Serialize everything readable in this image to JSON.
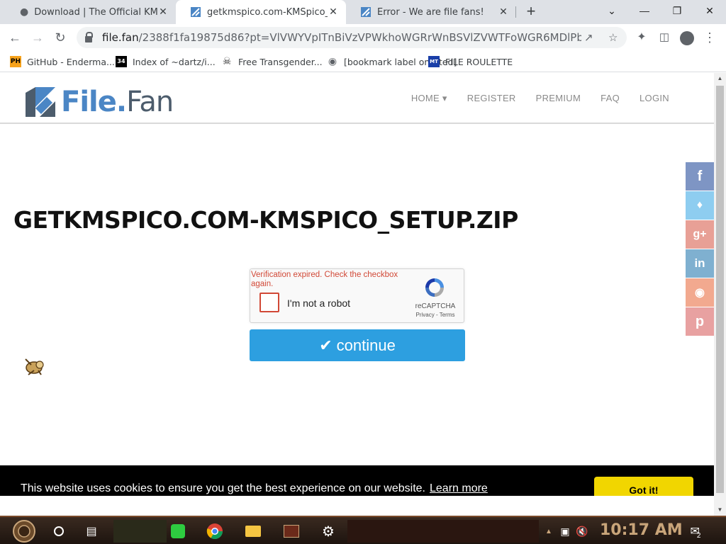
{
  "browser": {
    "tabs": [
      {
        "title": "Download | The Official KMSpico",
        "active": false
      },
      {
        "title": "getkmspico.com-KMSpico_setup.zip",
        "active": true
      },
      {
        "title": "Error - We are file fans!",
        "active": false
      }
    ],
    "url_host": "file.fan",
    "url_path": "/2388f1fa19875d86?pt=VlVWYVpITnBiVzVPWkhoWGRrWnBSVlZVWTFoWGR6MDlPbWVHN...",
    "bookmarks": [
      {
        "label": "GitHub - Enderma...",
        "icon": "PH"
      },
      {
        "label": "Index of ~dartz/i...",
        "icon": "34"
      },
      {
        "label": "Free Transgender...",
        "icon": "skull"
      },
      {
        "label": "[bookmark label omitted]",
        "icon": "globe"
      },
      {
        "label": "FILE ROULETTE",
        "icon": "MT"
      }
    ]
  },
  "site": {
    "logo_a": "File.",
    "logo_b": "Fan",
    "nav": [
      "HOME ▾",
      "REGISTER",
      "PREMIUM",
      "FAQ",
      "LOGIN"
    ]
  },
  "file_title": "GETKMSPICO.COM-KMSPICO_SETUP.ZIP",
  "captcha": {
    "error": "Verification expired. Check the checkbox again.",
    "label": "I'm not a robot",
    "brand": "reCAPTCHA",
    "links": "Privacy - Terms"
  },
  "continue_label": "continue",
  "social": [
    {
      "icon": "f",
      "color": "#7e95c4"
    },
    {
      "icon": "t",
      "color": "#8ecdf0"
    },
    {
      "icon": "g+",
      "color": "#e8a096"
    },
    {
      "icon": "in",
      "color": "#7fb0d0"
    },
    {
      "icon": "reddit",
      "color": "#f2a98f"
    },
    {
      "icon": "p",
      "color": "#e8a1a1"
    }
  ],
  "cookie": {
    "text": "This website uses cookies to ensure you get the best experience on our website.",
    "link": "Learn more",
    "button": "Got it!"
  },
  "taskbar": {
    "clock": "10:17 AM",
    "notifications": "2"
  }
}
